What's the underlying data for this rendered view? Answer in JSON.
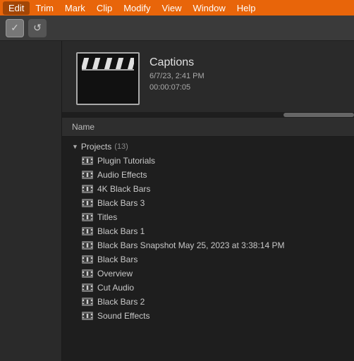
{
  "menubar": {
    "items": [
      "Edit",
      "Trim",
      "Mark",
      "Clip",
      "Modify",
      "View",
      "Window",
      "Help"
    ],
    "active_index": 0
  },
  "toolbar": {
    "btn1_label": "✓",
    "btn2_label": "↺"
  },
  "preview": {
    "title": "Captions",
    "date": "6/7/23, 2:41 PM",
    "duration": "00:00:07:05"
  },
  "browser": {
    "header_label": "Name",
    "projects_label": "Projects",
    "projects_count": "(13)",
    "items": [
      "Plugin Tutorials",
      "Audio Effects",
      "4K Black Bars",
      "Black Bars 3",
      "Titles",
      "Black Bars 1",
      "Black Bars Snapshot May 25, 2023 at 3:38:14 PM",
      "Black Bars",
      "Overview",
      "Cut Audio",
      "Black Bars 2",
      "Sound Effects"
    ]
  }
}
